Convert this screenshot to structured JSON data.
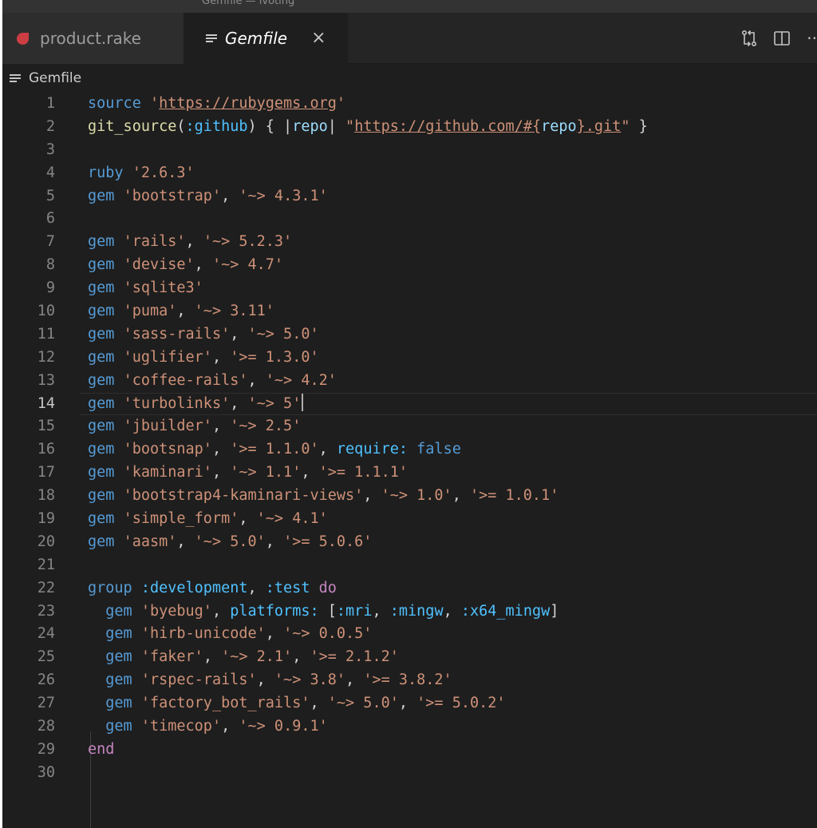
{
  "window": {
    "title": "Gemfile — ivoting"
  },
  "tabs": [
    {
      "label": "product.rake",
      "icon": "ruby-icon",
      "active": false
    },
    {
      "label": "Gemfile",
      "icon": "lines-icon",
      "active": true,
      "close_glyph": "×"
    }
  ],
  "tab_actions": [
    "git-compare-icon",
    "split-editor-icon",
    "more-actions-icon"
  ],
  "tab_actions_more_glyph": "··",
  "breadcrumb": {
    "label": "Gemfile"
  },
  "colors": {
    "background": "#1e1e1e",
    "keyword": "#569cd6",
    "string": "#ce9178",
    "symbol": "#4fc1ff",
    "function": "#dcdcaa",
    "control": "#c586c0",
    "variable": "#9cdcfe",
    "line_number": "#858585"
  },
  "editor": {
    "current_line": 14,
    "lines": [
      [
        [
          "kw",
          "source "
        ],
        [
          "str",
          "'"
        ],
        [
          "url",
          "https://rubygems.org"
        ],
        [
          "str",
          "'"
        ]
      ],
      [
        [
          "fn",
          "git_source"
        ],
        [
          "plain",
          "("
        ],
        [
          "sym",
          ":github"
        ],
        [
          "plain",
          ") { |"
        ],
        [
          "var",
          "repo"
        ],
        [
          "plain",
          "| "
        ],
        [
          "str",
          "\""
        ],
        [
          "url",
          "https://github.com/"
        ],
        [
          "url",
          "#{"
        ],
        [
          "var",
          "repo"
        ],
        [
          "url",
          "}"
        ],
        [
          "url",
          ".git"
        ],
        [
          "str",
          "\""
        ],
        [
          "plain",
          " }"
        ]
      ],
      [],
      [
        [
          "kw",
          "ruby "
        ],
        [
          "str",
          "'2.6.3'"
        ]
      ],
      [
        [
          "kw",
          "gem "
        ],
        [
          "str",
          "'bootstrap'"
        ],
        [
          "plain",
          ", "
        ],
        [
          "str",
          "'~> 4.3.1'"
        ]
      ],
      [],
      [
        [
          "kw",
          "gem "
        ],
        [
          "str",
          "'rails'"
        ],
        [
          "plain",
          ", "
        ],
        [
          "str",
          "'~> 5.2.3'"
        ]
      ],
      [
        [
          "kw",
          "gem "
        ],
        [
          "str",
          "'devise'"
        ],
        [
          "plain",
          ", "
        ],
        [
          "str",
          "'~> 4.7'"
        ]
      ],
      [
        [
          "kw",
          "gem "
        ],
        [
          "str",
          "'sqlite3'"
        ]
      ],
      [
        [
          "kw",
          "gem "
        ],
        [
          "str",
          "'puma'"
        ],
        [
          "plain",
          ", "
        ],
        [
          "str",
          "'~> 3.11'"
        ]
      ],
      [
        [
          "kw",
          "gem "
        ],
        [
          "str",
          "'sass-rails'"
        ],
        [
          "plain",
          ", "
        ],
        [
          "str",
          "'~> 5.0'"
        ]
      ],
      [
        [
          "kw",
          "gem "
        ],
        [
          "str",
          "'uglifier'"
        ],
        [
          "plain",
          ", "
        ],
        [
          "str",
          "'>= 1.3.0'"
        ]
      ],
      [
        [
          "kw",
          "gem "
        ],
        [
          "str",
          "'coffee-rails'"
        ],
        [
          "plain",
          ", "
        ],
        [
          "str",
          "'~> 4.2'"
        ]
      ],
      [
        [
          "kw",
          "gem "
        ],
        [
          "str",
          "'turbolinks'"
        ],
        [
          "plain",
          ", "
        ],
        [
          "str",
          "'~> 5'"
        ]
      ],
      [
        [
          "kw",
          "gem "
        ],
        [
          "str",
          "'jbuilder'"
        ],
        [
          "plain",
          ", "
        ],
        [
          "str",
          "'~> 2.5'"
        ]
      ],
      [
        [
          "kw",
          "gem "
        ],
        [
          "str",
          "'bootsnap'"
        ],
        [
          "plain",
          ", "
        ],
        [
          "str",
          "'>= 1.1.0'"
        ],
        [
          "plain",
          ", "
        ],
        [
          "sym",
          "require:"
        ],
        [
          "plain",
          " "
        ],
        [
          "kw",
          "false"
        ]
      ],
      [
        [
          "kw",
          "gem "
        ],
        [
          "str",
          "'kaminari'"
        ],
        [
          "plain",
          ", "
        ],
        [
          "str",
          "'~> 1.1'"
        ],
        [
          "plain",
          ", "
        ],
        [
          "str",
          "'>= 1.1.1'"
        ]
      ],
      [
        [
          "kw",
          "gem "
        ],
        [
          "str",
          "'bootstrap4-kaminari-views'"
        ],
        [
          "plain",
          ", "
        ],
        [
          "str",
          "'~> 1.0'"
        ],
        [
          "plain",
          ", "
        ],
        [
          "str",
          "'>= 1.0.1'"
        ]
      ],
      [
        [
          "kw",
          "gem "
        ],
        [
          "str",
          "'simple_form'"
        ],
        [
          "plain",
          ", "
        ],
        [
          "str",
          "'~> 4.1'"
        ]
      ],
      [
        [
          "kw",
          "gem "
        ],
        [
          "str",
          "'aasm'"
        ],
        [
          "plain",
          ", "
        ],
        [
          "str",
          "'~> 5.0'"
        ],
        [
          "plain",
          ", "
        ],
        [
          "str",
          "'>= 5.0.6'"
        ]
      ],
      [],
      [
        [
          "kw",
          "group "
        ],
        [
          "sym",
          ":development"
        ],
        [
          "plain",
          ", "
        ],
        [
          "sym",
          ":test"
        ],
        [
          "plain",
          " "
        ],
        [
          "ctrl",
          "do"
        ]
      ],
      [
        [
          "plain",
          "  "
        ],
        [
          "kw",
          "gem "
        ],
        [
          "str",
          "'byebug'"
        ],
        [
          "plain",
          ", "
        ],
        [
          "sym",
          "platforms:"
        ],
        [
          "plain",
          " ["
        ],
        [
          "sym",
          ":mri"
        ],
        [
          "plain",
          ", "
        ],
        [
          "sym",
          ":mingw"
        ],
        [
          "plain",
          ", "
        ],
        [
          "sym",
          ":x64_mingw"
        ],
        [
          "plain",
          "]"
        ]
      ],
      [
        [
          "plain",
          "  "
        ],
        [
          "kw",
          "gem "
        ],
        [
          "str",
          "'hirb-unicode'"
        ],
        [
          "plain",
          ", "
        ],
        [
          "str",
          "'~> 0.0.5'"
        ]
      ],
      [
        [
          "plain",
          "  "
        ],
        [
          "kw",
          "gem "
        ],
        [
          "str",
          "'faker'"
        ],
        [
          "plain",
          ", "
        ],
        [
          "str",
          "'~> 2.1'"
        ],
        [
          "plain",
          ", "
        ],
        [
          "str",
          "'>= 2.1.2'"
        ]
      ],
      [
        [
          "plain",
          "  "
        ],
        [
          "kw",
          "gem "
        ],
        [
          "str",
          "'rspec-rails'"
        ],
        [
          "plain",
          ", "
        ],
        [
          "str",
          "'~> 3.8'"
        ],
        [
          "plain",
          ", "
        ],
        [
          "str",
          "'>= 3.8.2'"
        ]
      ],
      [
        [
          "plain",
          "  "
        ],
        [
          "kw",
          "gem "
        ],
        [
          "str",
          "'factory_bot_rails'"
        ],
        [
          "plain",
          ", "
        ],
        [
          "str",
          "'~> 5.0'"
        ],
        [
          "plain",
          ", "
        ],
        [
          "str",
          "'>= 5.0.2'"
        ]
      ],
      [
        [
          "plain",
          "  "
        ],
        [
          "kw",
          "gem "
        ],
        [
          "str",
          "'timecop'"
        ],
        [
          "plain",
          ", "
        ],
        [
          "str",
          "'~> 0.9.1'"
        ]
      ],
      [
        [
          "ctrl",
          "end"
        ]
      ],
      []
    ]
  }
}
